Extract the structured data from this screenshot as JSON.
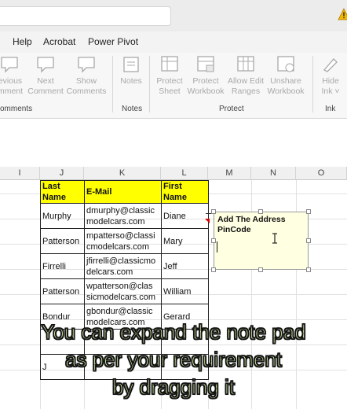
{
  "ribbon_tabs": [
    "Help",
    "Acrobat",
    "Power Pivot"
  ],
  "ribbon": {
    "comments_group": {
      "label": "omments",
      "buttons": [
        {
          "line1": "evious",
          "line2": "mment",
          "icon": "previous-comment-icon"
        },
        {
          "line1": "Next",
          "line2": "Comment",
          "icon": "next-comment-icon"
        },
        {
          "line1": "Show",
          "line2": "Comments",
          "icon": "show-comments-icon"
        }
      ]
    },
    "notes_group": {
      "label": "Notes",
      "buttons": [
        {
          "line1": "Notes",
          "line2": "",
          "icon": "notes-icon"
        }
      ]
    },
    "protect_group": {
      "label": "Protect",
      "buttons": [
        {
          "line1": "Protect",
          "line2": "Sheet",
          "icon": "protect-sheet-icon"
        },
        {
          "line1": "Protect",
          "line2": "Workbook",
          "icon": "protect-workbook-icon"
        },
        {
          "line1": "Allow Edit",
          "line2": "Ranges",
          "icon": "allow-edit-ranges-icon"
        },
        {
          "line1": "Unshare",
          "line2": "Workbook",
          "icon": "unshare-workbook-icon"
        }
      ]
    },
    "ink_group": {
      "label": "Ink",
      "buttons": [
        {
          "line1": "Hide",
          "line2": "Ink ˅",
          "icon": "hide-ink-icon"
        }
      ]
    }
  },
  "columns": [
    "I",
    "J",
    "K",
    "L",
    "M",
    "N",
    "O"
  ],
  "table": {
    "headers": [
      "Last Name",
      "E-Mail",
      "First Name"
    ],
    "rows": [
      {
        "last": "Murphy",
        "email1": "dmurphy@classic",
        "email2": "modelcars.com",
        "first": "Diane"
      },
      {
        "last": "Patterson",
        "email1": "mpatterso@classi",
        "email2": "cmodelcars.com",
        "first": "Mary"
      },
      {
        "last": "Firrelli",
        "email1": "jfirrelli@classicmo",
        "email2": "delcars.com",
        "first": "Jeff"
      },
      {
        "last": "Patterson",
        "email1": "wpatterson@clas",
        "email2": "sicmodelcars.com",
        "first": "William"
      },
      {
        "last": "Bondur",
        "email1": "gbondur@classic",
        "email2": "modelcars.com",
        "first": "Gerard"
      },
      {
        "last": "",
        "email1": "",
        "email2": "",
        "first": ""
      },
      {
        "last": "J",
        "email1": "",
        "email2": "",
        "first": ""
      }
    ]
  },
  "note": {
    "line1": "Add The Address",
    "line2": "PinCode"
  },
  "caption": {
    "line1": "You can expand the note pad",
    "line2": "as per your requirement",
    "line3": "by dragging it"
  }
}
